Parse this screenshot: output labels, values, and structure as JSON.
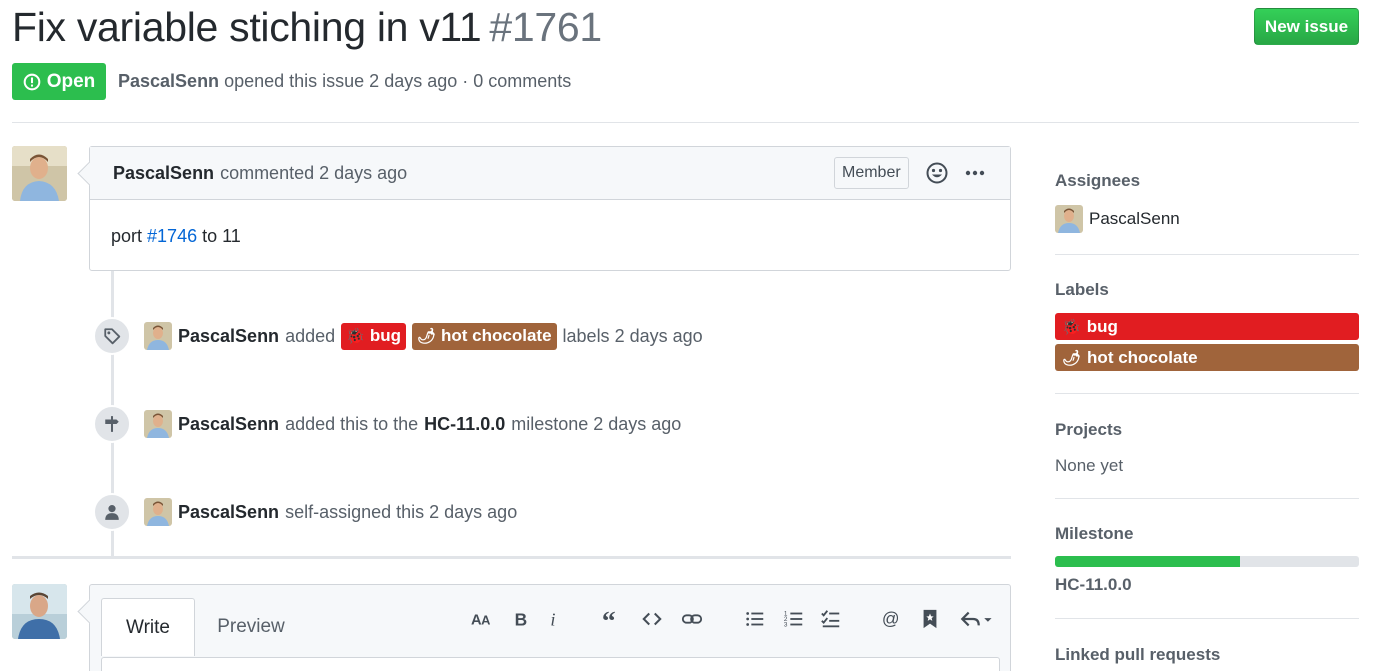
{
  "issue": {
    "title": "Fix variable stiching in v11",
    "number": "#1761",
    "state": "Open",
    "author": "PascalSenn",
    "meta_text": "opened this issue 2 days ago · 0 comments"
  },
  "header": {
    "new_issue_label": "New issue"
  },
  "comment": {
    "author": "PascalSenn",
    "action": "commented 2 days ago",
    "badge": "Member",
    "body_prefix": "port ",
    "body_link": "#1746",
    "body_suffix": " to 11"
  },
  "timeline": [
    {
      "icon": "tag-icon",
      "author": "PascalSenn",
      "pre": "added",
      "post": "labels 2 days ago"
    },
    {
      "icon": "milestone-icon",
      "author": "PascalSenn",
      "pre": "added this to the",
      "milestone": "HC-11.0.0",
      "post": "milestone 2 days ago"
    },
    {
      "icon": "person-icon",
      "author": "PascalSenn",
      "pre": "self-assigned this 2 days ago"
    }
  ],
  "labels": [
    {
      "name": "bug",
      "emoji": "🐞",
      "color": "#e11d21"
    },
    {
      "name": "hot chocolate",
      "emoji": "🌶",
      "color": "#a0643b"
    }
  ],
  "form": {
    "tab_write": "Write",
    "tab_preview": "Preview",
    "toolbar_icons": [
      "text-size-icon",
      "bold-icon",
      "italic-icon",
      "quote-icon",
      "code-icon",
      "link-icon",
      "unordered-list-icon",
      "ordered-list-icon",
      "task-list-icon",
      "mention-icon",
      "saved-reply-icon",
      "reply-icon"
    ]
  },
  "sidebar": {
    "assignees_heading": "Assignees",
    "assignee": "PascalSenn",
    "labels_heading": "Labels",
    "projects_heading": "Projects",
    "projects_value": "None yet",
    "milestone_heading": "Milestone",
    "milestone_name": "HC-11.0.0",
    "milestone_progress": 0.61,
    "linked_heading": "Linked pull requests"
  },
  "colors": {
    "green": "#2cbe4e",
    "link": "#0366d6",
    "bug": "#e11d21",
    "hot": "#a0643b"
  }
}
